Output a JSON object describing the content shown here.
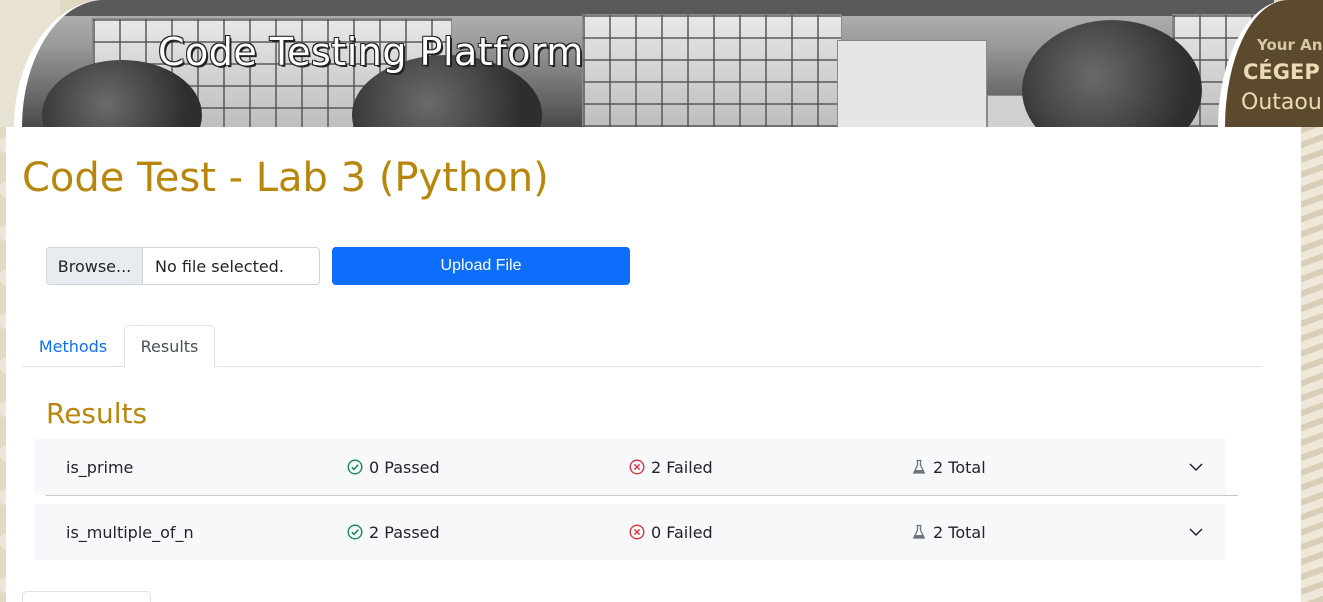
{
  "banner": {
    "title": "Code Testing Platform",
    "brand_line1": "Your Ang",
    "brand_line2": "CÉGEP i",
    "brand_line3": "Outaou"
  },
  "page": {
    "title": "Code Test - Lab 3 (Python)"
  },
  "upload": {
    "browse_label": "Browse...",
    "file_status": "No file selected.",
    "upload_label": "Upload File"
  },
  "tabs": [
    {
      "label": "Methods",
      "active": false
    },
    {
      "label": "Results",
      "active": true
    }
  ],
  "results": {
    "heading": "Results",
    "rows": [
      {
        "name": "is_prime",
        "passed": "0 Passed",
        "failed": "2 Failed",
        "total": "2 Total"
      },
      {
        "name": "is_multiple_of_n",
        "passed": "2 Passed",
        "failed": "0 Failed",
        "total": "2 Total"
      }
    ]
  },
  "colors": {
    "accent_gold": "#b8860b",
    "primary_blue": "#0d6efd",
    "passed_green": "#198754",
    "failed_red": "#dc3545",
    "total_gray": "#6c757d",
    "brand_brown": "#5b4a2e"
  },
  "icons": {
    "passed": "check-circle-icon",
    "failed": "x-circle-icon",
    "total": "flask-icon",
    "expand": "chevron-down-icon"
  }
}
